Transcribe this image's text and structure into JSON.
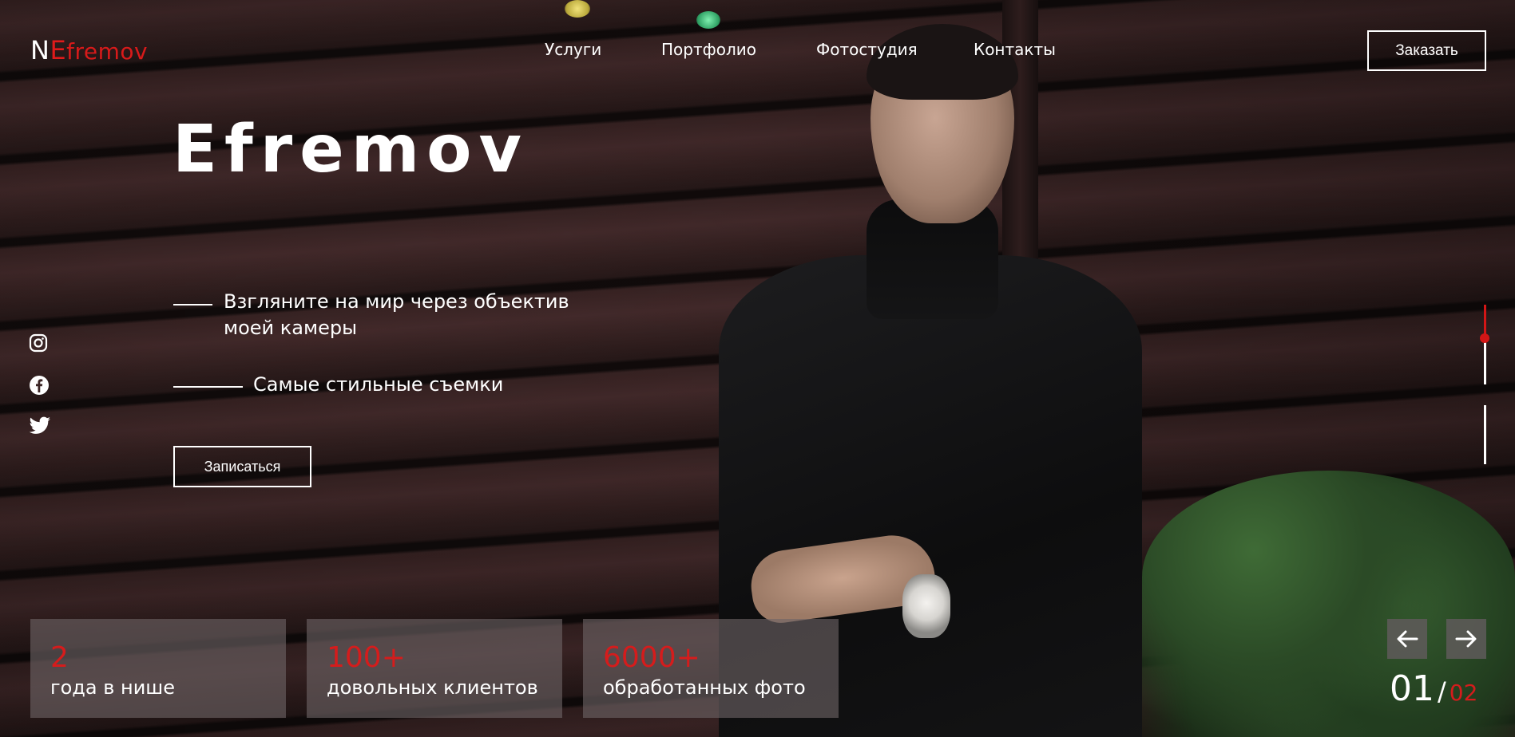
{
  "header": {
    "logo": {
      "first": "N",
      "accent": "E",
      "rest": "fremov"
    },
    "nav": [
      {
        "label": "Услуги"
      },
      {
        "label": "Портфолио"
      },
      {
        "label": "Фотостудия"
      },
      {
        "label": "Контакты"
      }
    ],
    "order_button": "Заказать"
  },
  "hero": {
    "title": "Efremov",
    "tagline_1_line1": "Взгляните на мир через объектив",
    "tagline_1_line2": "моей камеры",
    "tagline_2": "Самые стильные съемки",
    "signup_button": "Записаться"
  },
  "social": [
    {
      "icon": "instagram-icon"
    },
    {
      "icon": "facebook-icon"
    },
    {
      "icon": "twitter-icon"
    }
  ],
  "stats": [
    {
      "value": "2",
      "label": "года в нише"
    },
    {
      "value": "100+",
      "label": "довольных клиентов"
    },
    {
      "value": "6000+",
      "label": "обработанных фото"
    }
  ],
  "slider": {
    "current": "01",
    "separator": "/",
    "total": "02",
    "prev_icon": "arrow-left-icon",
    "next_icon": "arrow-right-icon"
  },
  "colors": {
    "accent": "#d51c1c",
    "text": "#ffffff",
    "stat_card_bg": "rgba(110,100,102,0.62)"
  }
}
